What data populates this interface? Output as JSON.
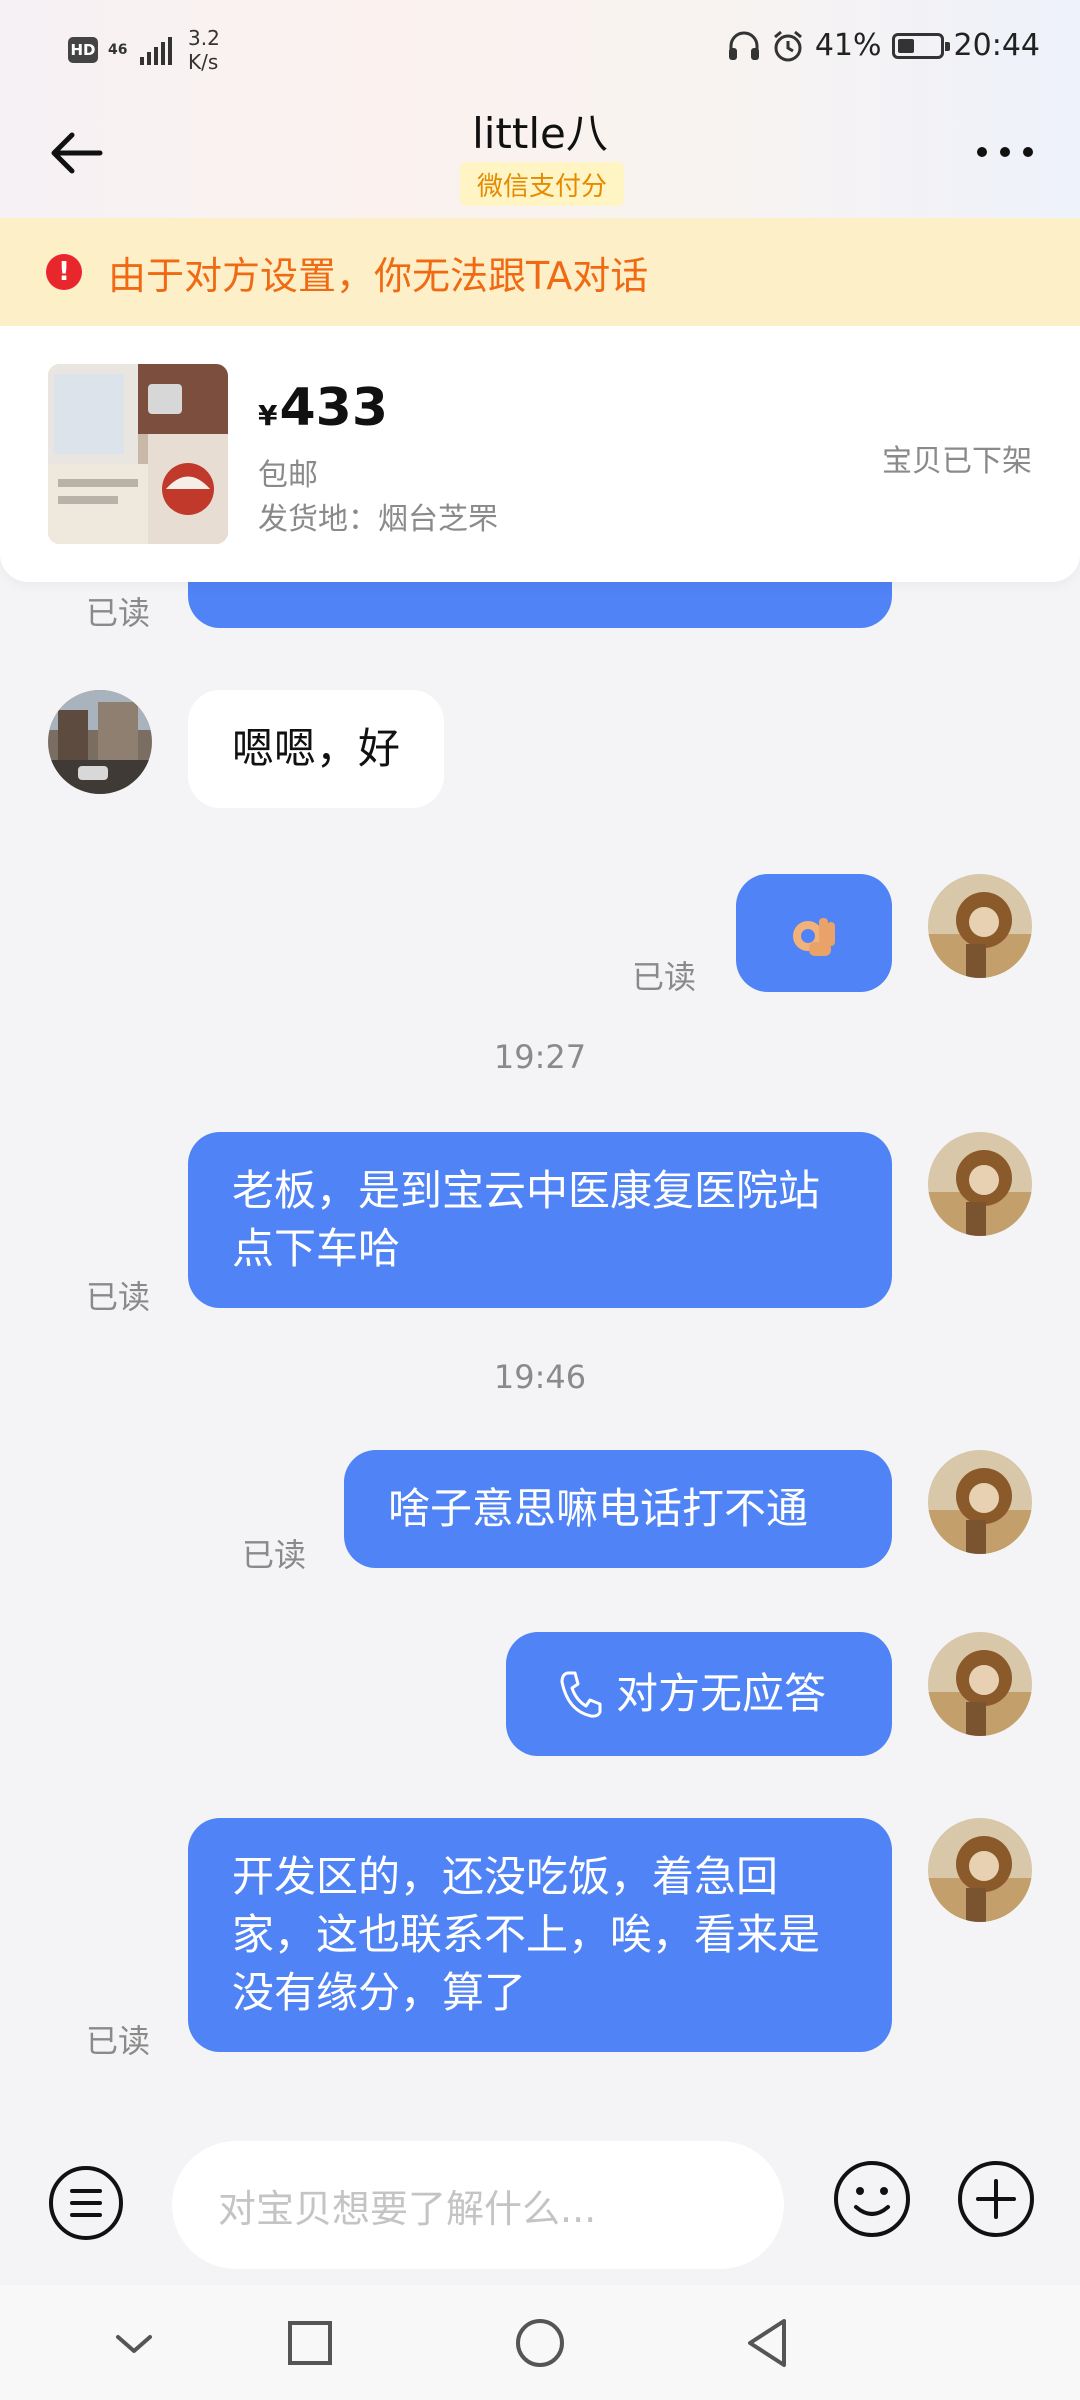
{
  "status_bar": {
    "hd": "HD",
    "network": "46",
    "speed_value": "3.2",
    "speed_unit": "K/s",
    "battery": "41%",
    "battery_level": 0.41,
    "time": "20:44",
    "icons": [
      "headphones-icon",
      "alarm-icon",
      "battery-icon"
    ]
  },
  "header": {
    "title": "little八",
    "badge": "微信支付分"
  },
  "warning": {
    "text": "由于对方设置，你无法跟TA对话",
    "icon": "exclamation-icon"
  },
  "product": {
    "currency": "¥",
    "price": "433",
    "shipping": "包邮",
    "origin": "发货地：烟台芝罘",
    "status": "宝贝已下架"
  },
  "messages": {
    "m0_read": "已读",
    "m1_text": "嗯嗯，好",
    "m2_read": "已读",
    "ts1": "19:27",
    "m3_text": "老板，是到宝云中医康复医院站点下车哈",
    "m3_read": "已读",
    "ts2": "19:46",
    "m4_text": "啥子意思嘛电话打不通",
    "m4_read": "已读",
    "m5_text": "对方无应答",
    "m6_text": "开发区的，还没吃饭，着急回家，这也联系不上，唉，看来是没有缘分，算了",
    "m6_read": "已读"
  },
  "input": {
    "placeholder": "对宝贝想要了解什么..."
  },
  "colors": {
    "accent": "#5083f6",
    "warning_bg": "#fdf0c8",
    "warning_text": "#f06a14",
    "badge_bg": "#fff4c4",
    "badge_text": "#e68a00"
  }
}
